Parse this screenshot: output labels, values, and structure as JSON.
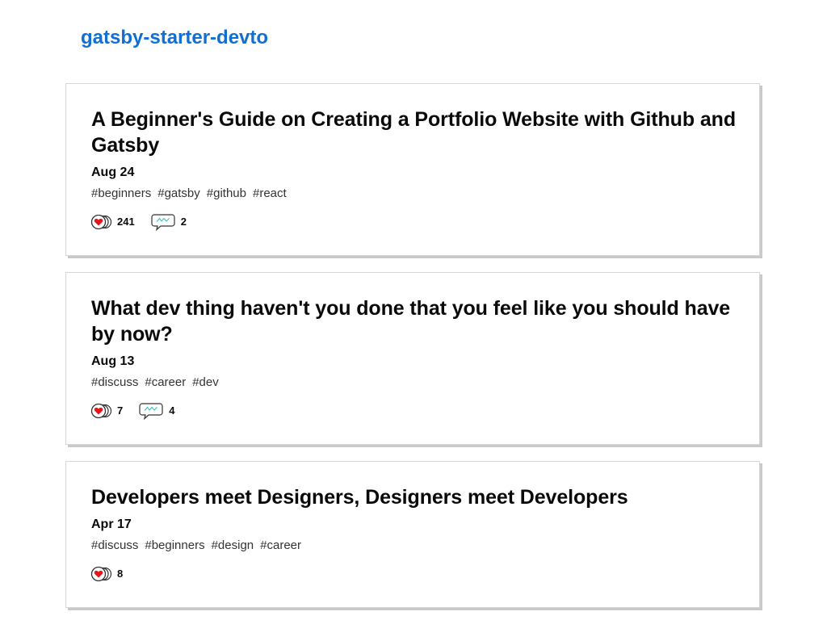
{
  "site": {
    "title": "gatsby-starter-devto"
  },
  "articles": [
    {
      "title": "A Beginner's Guide on Creating a Portfolio Website with Github and Gatsby",
      "date": "Aug 24",
      "tags": [
        "#beginners",
        "#gatsby",
        "#github",
        "#react"
      ],
      "reactions": "241",
      "comments": "2"
    },
    {
      "title": "What dev thing haven't you done that you feel like you should have by now?",
      "date": "Aug 13",
      "tags": [
        "#discuss",
        "#career",
        "#dev"
      ],
      "reactions": "7",
      "comments": "4"
    },
    {
      "title": "Developers meet Designers, Designers meet Developers",
      "date": "Apr 17",
      "tags": [
        "#discuss",
        "#beginners",
        "#design",
        "#career"
      ],
      "reactions": "8"
    }
  ],
  "icons": {
    "reactions": "heart-reactions-icon",
    "comments": "comment-bubble-icon"
  },
  "colors": {
    "link": "#0f6fd4",
    "heart": "#e8141b",
    "comment_squiggle": "#1ec2b5",
    "card_shadow": "#c9c9c9"
  }
}
